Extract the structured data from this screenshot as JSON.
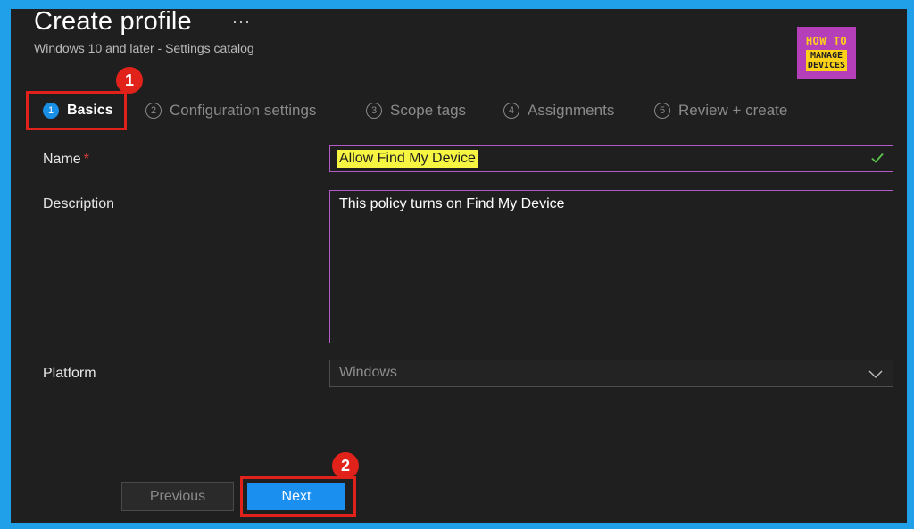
{
  "header": {
    "title": "Create profile",
    "more": "···",
    "subtitle": "Windows 10 and later - Settings catalog"
  },
  "logo": {
    "line1": "HOW TO",
    "line2": "MANAGE",
    "line3": "DEVICES"
  },
  "steps": [
    {
      "num": "1",
      "label": "Basics",
      "active": true
    },
    {
      "num": "2",
      "label": "Configuration settings"
    },
    {
      "num": "3",
      "label": "Scope tags"
    },
    {
      "num": "4",
      "label": "Assignments"
    },
    {
      "num": "5",
      "label": "Review + create"
    }
  ],
  "annotations": {
    "badge1": "1",
    "badge2": "2"
  },
  "form": {
    "name_label": "Name",
    "required_mark": "*",
    "name_value": "Allow Find My Device",
    "description_label": "Description",
    "description_value": "This policy turns on Find My Device",
    "platform_label": "Platform",
    "platform_value": "Windows"
  },
  "buttons": {
    "previous": "Previous",
    "next": "Next"
  },
  "colors": {
    "accent": "#1b8ff0",
    "highlight_box": "#e0221a",
    "field_border": "#b35cc8"
  }
}
